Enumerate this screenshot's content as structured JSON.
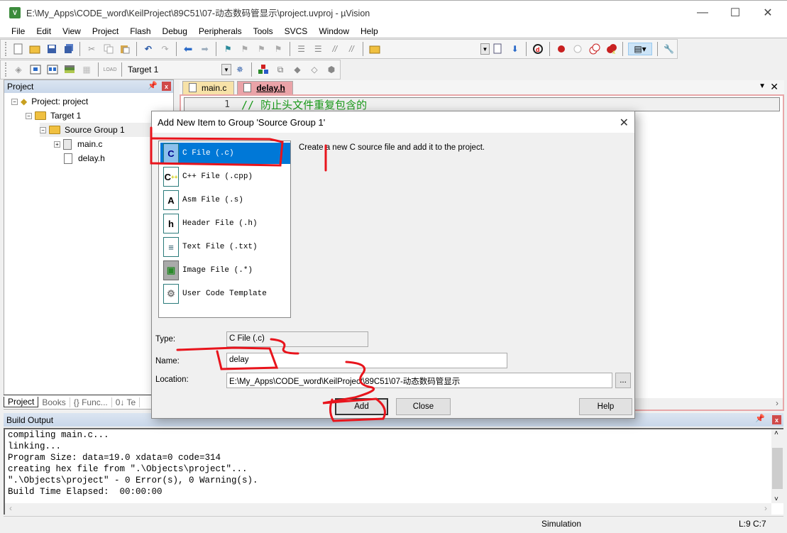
{
  "window": {
    "title": "E:\\My_Apps\\CODE_word\\KeilProject\\89C51\\07-动态数码管显示\\project.uvproj - µVision",
    "app_icon": "keil-uvision-icon",
    "controls": [
      "minimize",
      "maximize",
      "close"
    ]
  },
  "menubar": [
    "File",
    "Edit",
    "View",
    "Project",
    "Flash",
    "Debug",
    "Peripherals",
    "Tools",
    "SVCS",
    "Window",
    "Help"
  ],
  "toolbar2": {
    "target_select": "Target 1"
  },
  "project_panel": {
    "title": "Project",
    "tree": [
      {
        "label": "Project: project",
        "level": 0,
        "expanded": true
      },
      {
        "label": "Target 1",
        "level": 1,
        "expanded": true
      },
      {
        "label": "Source Group 1",
        "level": 2,
        "expanded": true,
        "selected": true
      },
      {
        "label": "main.c",
        "level": 3,
        "expandable": true
      },
      {
        "label": "delay.h",
        "level": 3
      }
    ],
    "tabs": [
      "Project",
      "Books",
      "{} Func...",
      "0↓ Te"
    ]
  },
  "editor": {
    "tabs": [
      {
        "label": "main.c",
        "active": false
      },
      {
        "label": "delay.h",
        "active": true
      }
    ],
    "lines": [
      {
        "no": "1",
        "text": "// 防止头文件重复包含的"
      }
    ]
  },
  "dialog": {
    "title": "Add New Item to Group 'Source Group 1'",
    "types": [
      {
        "icon": "C",
        "label": "C File (.c)",
        "selected": true
      },
      {
        "icon": "C++",
        "label": "C++ File (.cpp)"
      },
      {
        "icon": "A",
        "label": "Asm File (.s)"
      },
      {
        "icon": "h",
        "label": "Header File (.h)"
      },
      {
        "icon": "≡",
        "label": "Text File (.txt)"
      },
      {
        "icon": "img",
        "label": "Image File (.*)"
      },
      {
        "icon": "gear",
        "label": "User Code Template"
      }
    ],
    "description": "Create a new C source file and add it to the project.",
    "type_label": "Type:",
    "type_value": "C File (.c)",
    "name_label": "Name:",
    "name_value": "delay",
    "location_label": "Location:",
    "location_value": "E:\\My_Apps\\CODE_word\\KeilProject\\89C51\\07-动态数码管显示",
    "browse_label": "...",
    "add_label": "Add",
    "close_label": "Close",
    "help_label": "Help"
  },
  "build_output": {
    "title": "Build Output",
    "lines": [
      "compiling main.c...",
      "linking...",
      "Program Size: data=19.0 xdata=0 code=314",
      "creating hex file from \".\\Objects\\project\"...",
      "\".\\Objects\\project\" - 0 Error(s), 0 Warning(s).",
      "Build Time Elapsed:  00:00:00"
    ]
  },
  "statusbar": {
    "mode": "Simulation",
    "position": "L:9 C:7"
  },
  "annotations": {
    "color": "#e8141c",
    "marks": [
      "1",
      "2",
      "3"
    ]
  }
}
